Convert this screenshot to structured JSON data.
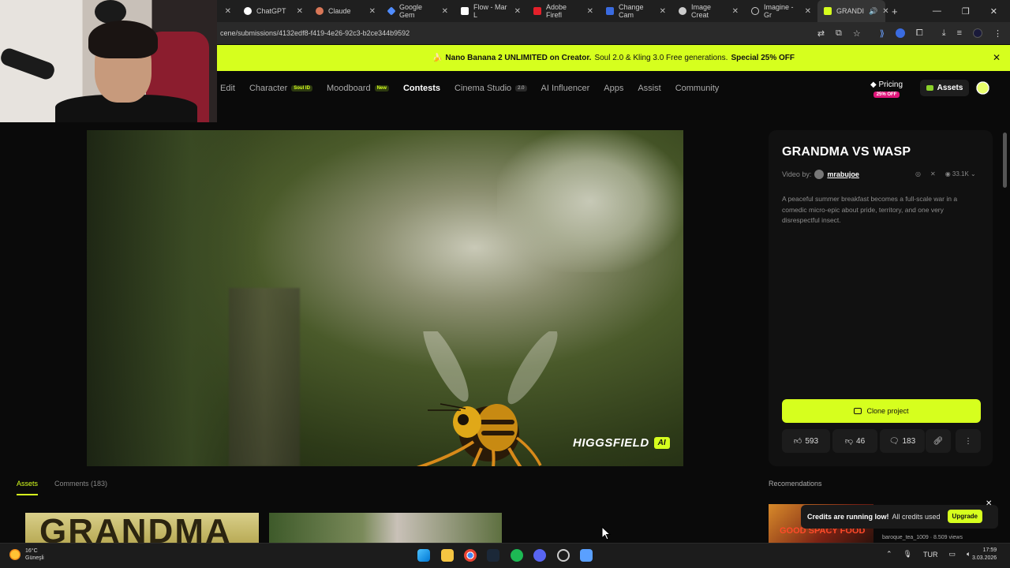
{
  "webcam": {
    "label": "streamer webcam"
  },
  "browser": {
    "tabs": [
      {
        "label": "ChatGPT",
        "color": "#ffffff"
      },
      {
        "label": "Claude",
        "color": "#d97757"
      },
      {
        "label": "Google Gem",
        "color": "#4f8cff"
      },
      {
        "label": "Flow - Mar L",
        "color": "#ffffff"
      },
      {
        "label": "Adobe Firefl",
        "color": "#e4202a"
      },
      {
        "label": "Change Cam",
        "color": "#3a6be0"
      },
      {
        "label": "Image Creat",
        "color": "#cccccc"
      },
      {
        "label": "Imagine - Gr",
        "color": "#cccccc"
      },
      {
        "label": "GRANDI",
        "color": "#d6ff1e"
      }
    ],
    "new_tab": "+",
    "url": "cene/submissions/4132edf8-f419-4e26-92c3-b2ce344b9592"
  },
  "promo": {
    "bold1": "Nano Banana 2 UNLIMITED on Creator.",
    "text": "Soul 2.0 & Kling 3.0 Free generations.",
    "bold2": "Special 25% OFF",
    "close": "✕"
  },
  "nav": {
    "items": [
      {
        "label": "Edit"
      },
      {
        "label": "Character",
        "badge": "Soul ID"
      },
      {
        "label": "Moodboard",
        "badge": "New"
      },
      {
        "label": "Contests"
      },
      {
        "label": "Cinema Studio",
        "badge": "2.0"
      },
      {
        "label": "AI Influencer"
      },
      {
        "label": "Apps"
      },
      {
        "label": "Assist"
      },
      {
        "label": "Community"
      }
    ],
    "pricing": "Pricing",
    "pricing_badge": "25% OFF",
    "assets": "Assets"
  },
  "video": {
    "watermark": "HIGGSFIELD",
    "watermark_badge": "AI"
  },
  "panel": {
    "title": "GRANDMA VS WASP",
    "video_by": "Video by:",
    "username": "mrabujoe",
    "views": "33.1K",
    "description": "A peaceful summer breakfast becomes a full-scale war in a comedic micro-epic about pride, territory, and one very disrespectful insect.",
    "clone": "Clone project",
    "likes": "593",
    "dislikes": "46",
    "comments": "183"
  },
  "lower": {
    "tab_assets": "Assets",
    "tab_comments": "Comments (183)",
    "thumb1_text": "GRANDMA",
    "recommendations": "Recomendations",
    "rec_thumb_text": "GOOD SPACY FOOD",
    "rec_info": "baroque_tea_1009 · 8.509 views",
    "toast_bold": "Credits are running low!",
    "toast_text": "All credits used",
    "upgrade": "Upgrade",
    "toast_close": "✕"
  },
  "taskbar": {
    "temp": "16°C",
    "weather": "Güneşli",
    "lang": "TUR",
    "time": "17:59",
    "date": "3.03.2026"
  }
}
